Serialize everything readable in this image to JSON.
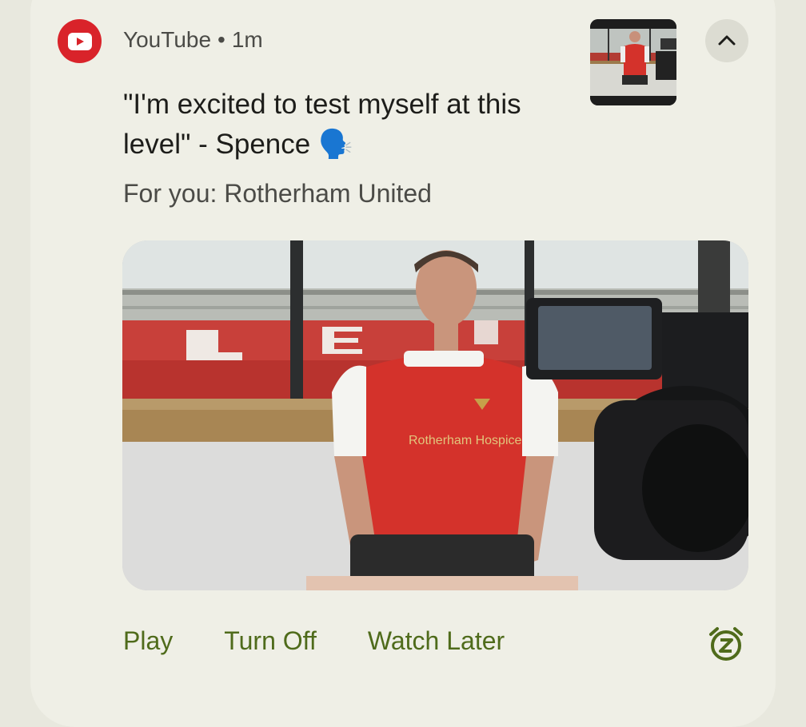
{
  "notification": {
    "app_name": "YouTube",
    "separator": "•",
    "time_ago": "1m",
    "title": "\"I'm excited to test myself at this level\" - Spence 🗣️",
    "subtext": "For you: Rotherham United",
    "shirt_sponsor": "Rotherham Hospice",
    "actions": [
      {
        "label": "Play"
      },
      {
        "label": "Turn Off"
      },
      {
        "label": "Watch Later"
      }
    ]
  },
  "colors": {
    "youtube_red": "#d9232a",
    "action_green": "#4f6b1b",
    "card_bg": "#efefe6",
    "jersey_red": "#d4322b"
  },
  "icons": {
    "app": "youtube-logo-icon",
    "expand": "chevron-up-icon",
    "snooze": "snooze-alarm-icon"
  }
}
